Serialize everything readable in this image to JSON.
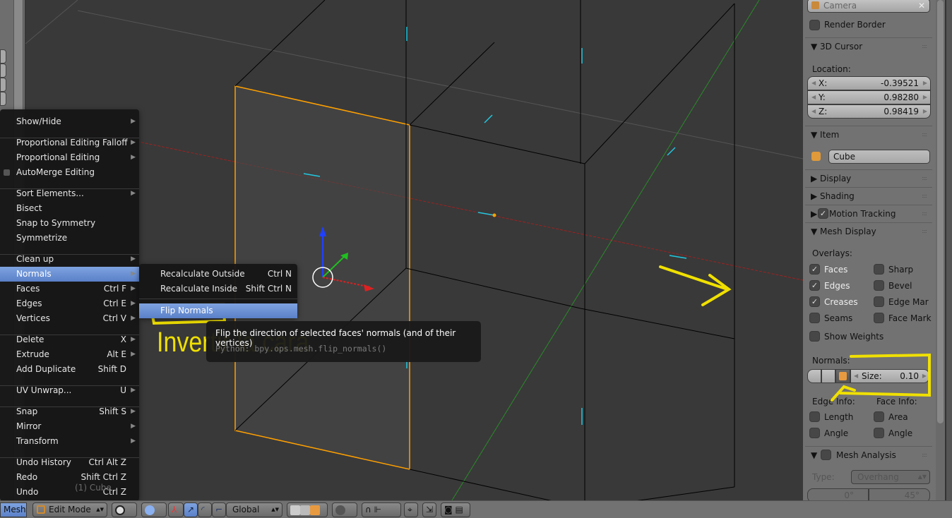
{
  "mesh_menu": {
    "items": [
      {
        "label": "Show/Hide",
        "shortcut": "",
        "submenu": true
      },
      {
        "label": "Proportional Editing Falloff",
        "shortcut": "",
        "submenu": true
      },
      {
        "label": "Proportional Editing",
        "shortcut": "",
        "submenu": true
      },
      {
        "label": "AutoMerge Editing",
        "shortcut": "",
        "submenu": false
      },
      {
        "label": "Sort Elements...",
        "shortcut": "",
        "submenu": true
      },
      {
        "label": "Bisect",
        "shortcut": "",
        "submenu": false
      },
      {
        "label": "Snap to Symmetry",
        "shortcut": "",
        "submenu": false
      },
      {
        "label": "Symmetrize",
        "shortcut": "",
        "submenu": false
      },
      {
        "label": "Clean up",
        "shortcut": "",
        "submenu": true
      },
      {
        "label": "Normals",
        "shortcut": "",
        "submenu": true
      },
      {
        "label": "Faces",
        "shortcut": "Ctrl F",
        "submenu": true
      },
      {
        "label": "Edges",
        "shortcut": "Ctrl E",
        "submenu": true
      },
      {
        "label": "Vertices",
        "shortcut": "Ctrl V",
        "submenu": true
      },
      {
        "label": "Delete",
        "shortcut": "X",
        "submenu": true
      },
      {
        "label": "Extrude",
        "shortcut": "Alt E",
        "submenu": true
      },
      {
        "label": "Add Duplicate",
        "shortcut": "Shift D",
        "submenu": false
      },
      {
        "label": "UV Unwrap...",
        "shortcut": "U",
        "submenu": true
      },
      {
        "label": "Snap",
        "shortcut": "Shift S",
        "submenu": true
      },
      {
        "label": "Mirror",
        "shortcut": "",
        "submenu": true
      },
      {
        "label": "Transform",
        "shortcut": "",
        "submenu": true
      },
      {
        "label": "Undo History",
        "shortcut": "Ctrl Alt Z",
        "submenu": false
      },
      {
        "label": "Redo",
        "shortcut": "Shift Ctrl Z",
        "submenu": false
      },
      {
        "label": "Undo",
        "shortcut": "Ctrl Z",
        "submenu": false
      }
    ]
  },
  "normals_submenu": {
    "items": [
      {
        "label": "Recalculate Outside",
        "shortcut": "Ctrl N"
      },
      {
        "label": "Recalculate Inside",
        "shortcut": "Shift Ctrl N"
      },
      {
        "label": "Flip Normals",
        "shortcut": ""
      }
    ]
  },
  "tooltip": {
    "description": "Flip the direction of selected faces' normals (and of their vertices)",
    "python": "Python: bpy.ops.mesh.flip_normals()"
  },
  "annotation": {
    "text": "Invertir la cara",
    "color": "#f0e000"
  },
  "viewport": {
    "object_label": "(1) Cube"
  },
  "properties_panel": {
    "camera_field": "Camera",
    "render_border": "Render Border",
    "cursor": {
      "title": "3D Cursor",
      "location_label": "Location:",
      "x_label": "X:",
      "x": "-0.39521",
      "y_label": "Y:",
      "y": "0.98280",
      "z_label": "Z:",
      "z": "0.98419"
    },
    "item": {
      "title": "Item",
      "name": "Cube"
    },
    "display": "Display",
    "shading": "Shading",
    "motion_tracking": "Motion Tracking",
    "mesh_display": {
      "title": "Mesh Display",
      "overlays_label": "Overlays:",
      "faces": "Faces",
      "edges": "Edges",
      "creases": "Creases",
      "seams": "Seams",
      "sharp": "Sharp",
      "bevel": "Bevel",
      "edge_mar": "Edge Mar",
      "face_mark": "Face Mark",
      "show_weights": "Show Weights",
      "normals_label": "Normals:",
      "size_label": "Size:",
      "size": "0.10",
      "edge_info": "Edge Info:",
      "face_info": "Face Info:",
      "length": "Length",
      "angle1": "Angle",
      "area": "Area",
      "angle2": "Angle"
    },
    "mesh_analysis": {
      "title": "Mesh Analysis",
      "type_label": "Type:",
      "type": "Overhang",
      "min": "0°",
      "max": "45°"
    }
  },
  "bottom_bar": {
    "mesh": "Mesh",
    "mode": "Edit Mode",
    "orientation": "Global"
  },
  "colors": {
    "accent": "#5a80c8",
    "selected": "#ffa000",
    "viewport": "#393939"
  }
}
